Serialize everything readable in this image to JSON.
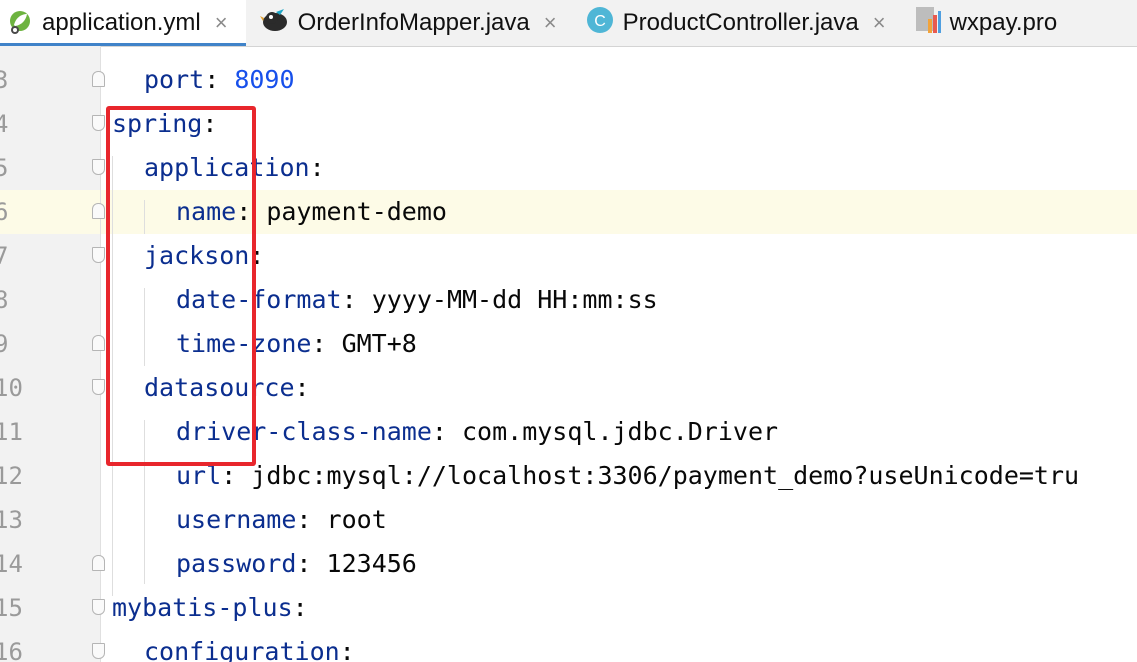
{
  "tabs": [
    {
      "label": "application.yml",
      "icon": "spring-leaf-icon",
      "active": true,
      "closable": true
    },
    {
      "label": "OrderInfoMapper.java",
      "icon": "mybatis-bird-icon",
      "active": false,
      "closable": true
    },
    {
      "label": "ProductController.java",
      "icon": "class-c-icon",
      "active": false,
      "closable": true
    },
    {
      "label": "wxpay.pro",
      "icon": "properties-file-icon",
      "active": false,
      "closable": false
    }
  ],
  "close_glyph": "×",
  "editor": {
    "caret_line": "6",
    "lines": [
      {
        "num": "3",
        "key": "port",
        "sep": ":",
        "value": " 8090",
        "value_kind": "number"
      },
      {
        "num": "4",
        "key": "spring",
        "sep": ":",
        "value": ""
      },
      {
        "num": "5",
        "key": "application",
        "sep": ":",
        "value": ""
      },
      {
        "num": "6",
        "key": "name",
        "sep": ":",
        "value": " payment-demo"
      },
      {
        "num": "7",
        "key": "jackson",
        "sep": ":",
        "value": ""
      },
      {
        "num": "8",
        "key": "date-format",
        "sep": ":",
        "value": " yyyy-MM-dd HH:mm:ss"
      },
      {
        "num": "9",
        "key": "time-zone",
        "sep": ":",
        "value": " GMT+8"
      },
      {
        "num": "10",
        "key": "datasource",
        "sep": ":",
        "value": ""
      },
      {
        "num": "11",
        "key": "driver-class-name",
        "sep": ":",
        "value": " com.mysql.jdbc.Driver"
      },
      {
        "num": "12",
        "key": "url",
        "sep": ":",
        "value": " jdbc:mysql://localhost:3306/payment_demo?useUnicode=tru"
      },
      {
        "num": "13",
        "key": "username",
        "sep": ":",
        "value": " root"
      },
      {
        "num": "14",
        "key": "password",
        "sep": ":",
        "value": " 123456"
      },
      {
        "num": "15",
        "key": "mybatis-plus",
        "sep": ":",
        "value": ""
      },
      {
        "num": "16",
        "key": "configuration",
        "sep": ":",
        "value": ""
      }
    ]
  },
  "colors": {
    "key": "#0b2e8f",
    "number": "#1750eb",
    "highlight_box": "#e8262c",
    "active_tab_underline": "#4083c9"
  }
}
